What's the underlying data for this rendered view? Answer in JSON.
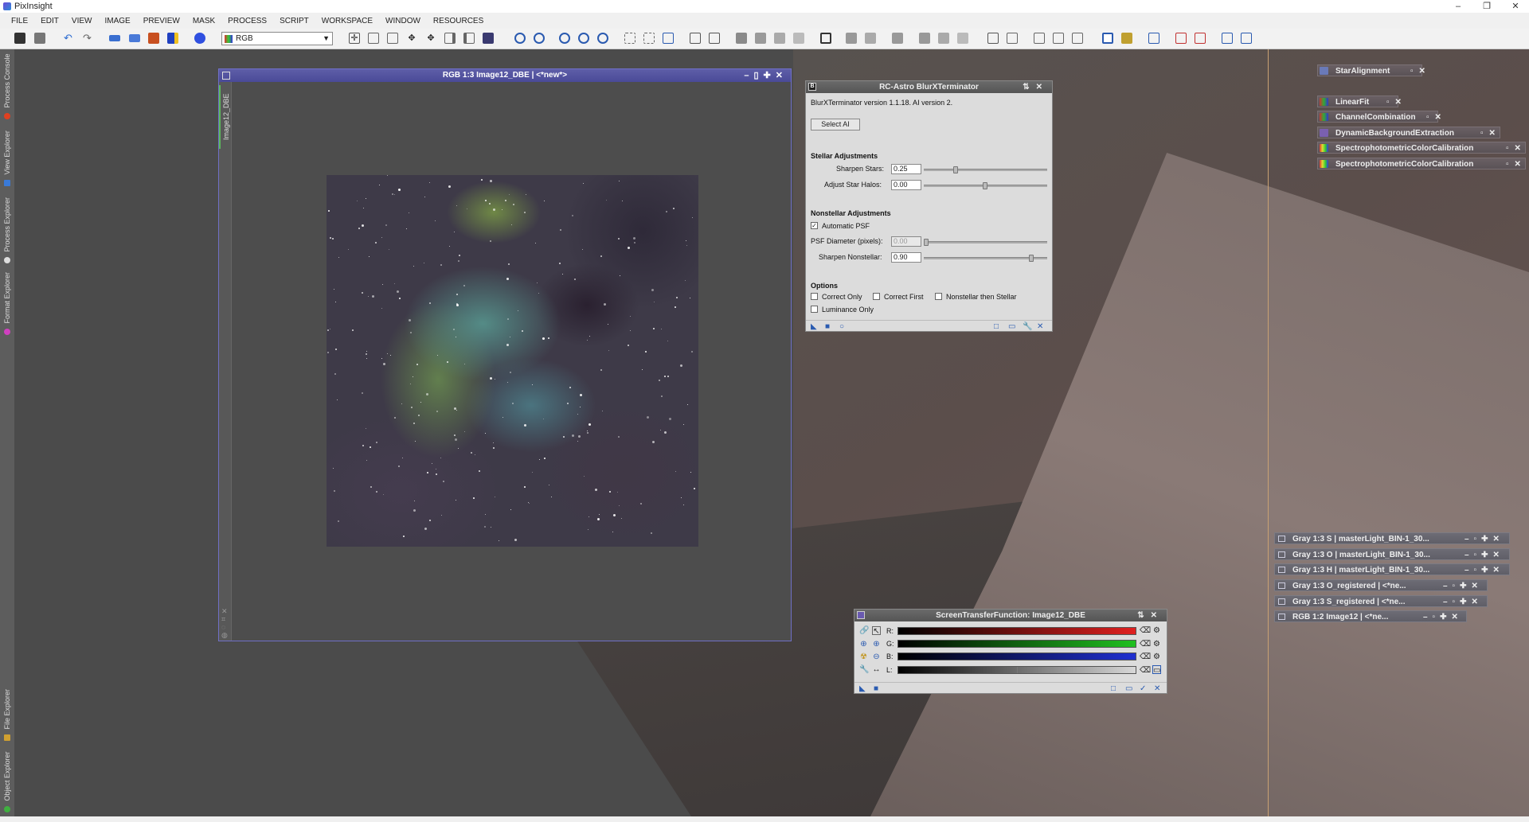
{
  "app": {
    "title": "PixInsight",
    "window_controls": [
      "–",
      "❐",
      "✕"
    ]
  },
  "menu": [
    "FILE",
    "EDIT",
    "VIEW",
    "IMAGE",
    "PREVIEW",
    "MASK",
    "PROCESS",
    "SCRIPT",
    "WORKSPACE",
    "WINDOW",
    "RESOURCES"
  ],
  "toolbar": {
    "color_mode": "RGB"
  },
  "left_tabs": [
    "Process Console",
    "View Explorer",
    "Process Explorer",
    "Format Explorer",
    "File Explorer",
    "Object Explorer"
  ],
  "image_window": {
    "title": "RGB 1:3 Image12_DBE | <*new*>",
    "side_tab": "Image12_DBE"
  },
  "blurx": {
    "title": "RC-Astro BlurXTerminator",
    "version": "BlurXTerminator version 1.1.18. AI version 2.",
    "select_ai": "Select AI",
    "stellar_header": "Stellar Adjustments",
    "sharpen_stars_label": "Sharpen Stars:",
    "sharpen_stars_value": "0.25",
    "sharpen_stars_level": 0.25,
    "halos_label": "Adjust Star Halos:",
    "halos_value": "0.00",
    "halos_level": 0.5,
    "nonstellar_header": "Nonstellar Adjustments",
    "auto_psf_label": "Automatic PSF",
    "auto_psf_checked": true,
    "psf_label": "PSF Diameter (pixels):",
    "psf_value": "0.00",
    "psf_level": 0.0,
    "sharpen_nonstellar_label": "Sharpen Nonstellar:",
    "sharpen_nonstellar_value": "0.90",
    "sharpen_nonstellar_level": 0.9,
    "options_header": "Options",
    "correct_only": "Correct Only",
    "correct_first": "Correct First",
    "nonstellar_then_stellar": "Nonstellar then Stellar",
    "luminance_only": "Luminance Only"
  },
  "process_icons": [
    "StarAlignment",
    "LinearFit",
    "ChannelCombination",
    "DynamicBackgroundExtraction",
    "SpectrophotometricColorCalibration",
    "SpectrophotometricColorCalibration"
  ],
  "iconified_windows": [
    "Gray 1:3 S | masterLight_BIN-1_30...",
    "Gray 1:3 O | masterLight_BIN-1_30...",
    "Gray 1:3 H | masterLight_BIN-1_30...",
    "Gray 1:3 O_registered | <*ne...",
    "Gray 1:3 S_registered | <*ne...",
    "RGB 1:2 Image12 | <*ne..."
  ],
  "stf": {
    "title": "ScreenTransferFunction: Image12_DBE",
    "channels": [
      "R:",
      "G:",
      "B:",
      "L:"
    ],
    "colors": {
      "R": "#e02020",
      "G": "#20c020",
      "B": "#2030d0",
      "L": "#d8d8d8"
    }
  }
}
